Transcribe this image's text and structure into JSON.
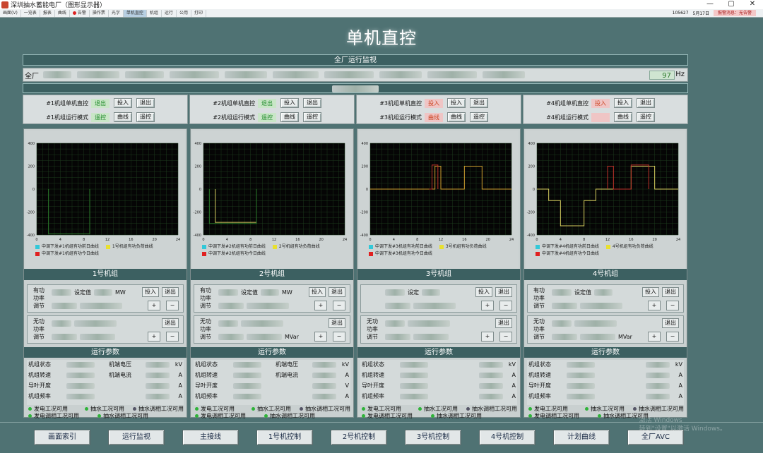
{
  "window": {
    "title": "深圳抽水蓄能电厂（图形显示器）",
    "buttons": {
      "minimize": "—",
      "maximize": "▢",
      "close": "✕"
    }
  },
  "toolbar": {
    "items": [
      "画面(V)",
      "一览表",
      "报表",
      "曲线",
      "告警",
      "操作票",
      "光字",
      "单机直控",
      "机组",
      "运行",
      "公用",
      "打印"
    ],
    "right_items": [
      "105627",
      "5月17日"
    ],
    "alarm_label": "报警消息：无告警"
  },
  "page": {
    "title": "单机直控"
  },
  "plant": {
    "section_title": "全厂运行监视",
    "row_label": "全厂",
    "frequency_value": "97",
    "frequency_unit": "Hz"
  },
  "controls": [
    {
      "direct_label": "#1机组单机直控",
      "direct_status": "退出",
      "mode_label": "#1机组运行模式",
      "mode_status": "遥控",
      "btn_in": "投入",
      "btn_out": "退出",
      "btn_curve": "曲线",
      "btn_remote": "遥控"
    },
    {
      "direct_label": "#2机组单机直控",
      "direct_status": "退出",
      "mode_label": "#2机组运行模式",
      "mode_status": "遥控",
      "btn_in": "投入",
      "btn_out": "退出",
      "btn_curve": "曲线",
      "btn_remote": "遥控"
    },
    {
      "direct_label": "#3机组单机直控",
      "direct_status": "投入",
      "mode_label": "#3机组运行模式",
      "mode_status": "曲线",
      "btn_in": "投入",
      "btn_out": "退出",
      "btn_curve": "曲线",
      "btn_remote": "遥控"
    },
    {
      "direct_label": "#4机组单机直控",
      "direct_status": "投入",
      "mode_label": "#4机组运行模式",
      "mode_status": "",
      "btn_in": "投入",
      "btn_out": "退出",
      "btn_curve": "曲线",
      "btn_remote": "遥控"
    }
  ],
  "units": [
    {
      "title": "1号机组",
      "legend": [
        "中调下发#1机组有功前日曲线",
        "1号机组有功负荷曲线",
        "中调下发#1机组有功今日曲线"
      ],
      "p_label": "有功\n功率\n调节",
      "q_label": "无功\n功率\n调节",
      "set_label": "设定值",
      "p_unit": "MW",
      "q_unit": "",
      "btn_in": "投入",
      "btn_out": "退出",
      "plus": "+",
      "minus": "−",
      "param_title": "运行参数",
      "params_left": [
        "机组状态",
        "机组转速",
        "导叶开度",
        "机组频率"
      ],
      "params_right": [
        "机端电压",
        "机端电流",
        "",
        ""
      ],
      "units_right": [
        "kV",
        "A",
        "A",
        "A"
      ],
      "cond": [
        "发电工况可用",
        "抽水工况可用",
        "抽水调相工况可用",
        "发电调相工况可用",
        "抽水调相工况可用"
      ]
    },
    {
      "title": "2号机组",
      "legend": [
        "中调下发#2机组有功前日曲线",
        "2号机组有功负荷曲线",
        "中调下发#2机组有功今日曲线"
      ],
      "p_label": "有功\n功率\n调节",
      "q_label": "无功\n功率\n调节",
      "set_label": "设定值",
      "p_unit": "MW",
      "q_unit": "MVar",
      "btn_in": "投入",
      "btn_out": "退出",
      "plus": "+",
      "minus": "−",
      "param_title": "运行参数",
      "params_left": [
        "机组状态",
        "机组转速",
        "导叶开度",
        "机组频率"
      ],
      "params_right": [
        "机端电压",
        "机端电流",
        "",
        ""
      ],
      "units_right": [
        "kV",
        "A",
        "V",
        "A"
      ],
      "cond": [
        "发电工况可用",
        "抽水工况可用",
        "抽水调相工况可用",
        "发电调相工况可用",
        "抽水调相工况可用"
      ]
    },
    {
      "title": "3号机组",
      "legend": [
        "中调下发#3机组有功前日曲线",
        "3号机组有功负荷曲线",
        "中调下发#3机组有功今日曲线"
      ],
      "p_label": "",
      "q_label": "无功\n功率\n调节",
      "set_label": "设定",
      "p_unit": "",
      "q_unit": "",
      "btn_in": "投入",
      "btn_out": "退出",
      "plus": "+",
      "minus": "−",
      "param_title": "运行参数",
      "params_left": [
        "机组状态",
        "机组转速",
        "导叶开度",
        "机组频率"
      ],
      "params_right": [
        "",
        "",
        "",
        ""
      ],
      "units_right": [
        "kV",
        "A",
        "A",
        "A"
      ],
      "cond": [
        "发电工况可用",
        "抽水工况可用",
        "抽水调相工况可用",
        "发电调相工况可用",
        "抽水调相工况可用"
      ]
    },
    {
      "title": "4号机组",
      "legend": [
        "中调下发#4机组有功前日曲线",
        "4号机组有功负荷曲线",
        "中调下发#4机组有功今日曲线"
      ],
      "p_label": "有功\n功率\n调节",
      "q_label": "无功\n功率\n调节",
      "set_label": "设定值",
      "p_unit": "",
      "q_unit": "MVar",
      "btn_in": "投入",
      "btn_out": "退出",
      "plus": "+",
      "minus": "−",
      "param_title": "运行参数",
      "params_left": [
        "机组状态",
        "机组转速",
        "导叶开度",
        "机组频率"
      ],
      "params_right": [
        "",
        "",
        "",
        ""
      ],
      "units_right": [
        "kV",
        "A",
        "A",
        "A"
      ],
      "cond": [
        "发电工况可用",
        "抽水工况可用",
        "抽水调相工况可用",
        "发电调相工况可用",
        "抽水调相工况可用"
      ]
    }
  ],
  "chart_data": [
    {
      "type": "line",
      "title": "",
      "xlabel": "",
      "ylabel": "",
      "xlim": [
        0,
        24
      ],
      "ylim": [
        -400,
        400
      ],
      "x_ticks": [
        0,
        4,
        8,
        12,
        16,
        20,
        24
      ],
      "y_ticks": [
        400,
        200,
        0,
        -200,
        -400
      ],
      "grid": true,
      "series": [
        {
          "color": "#2a7a2a",
          "points": [
            [
              2,
              0
            ],
            [
              2,
              -390
            ],
            [
              9,
              -390
            ],
            [
              9,
              0
            ]
          ]
        }
      ]
    },
    {
      "type": "line",
      "title": "",
      "xlabel": "",
      "ylabel": "",
      "xlim": [
        0,
        24
      ],
      "ylim": [
        -400,
        400
      ],
      "x_ticks": [
        0,
        4,
        8,
        12,
        16,
        20,
        24
      ],
      "y_ticks": [
        400,
        200,
        0,
        -200,
        -400
      ],
      "grid": true,
      "series": [
        {
          "color": "#d8d060",
          "points": [
            [
              2,
              0
            ],
            [
              2,
              -290
            ],
            [
              9,
              -290
            ],
            [
              9,
              0
            ]
          ]
        },
        {
          "color": "#2a7a2a",
          "points": [
            [
              1,
              0
            ],
            [
              1,
              -300
            ],
            [
              9,
              -300
            ],
            [
              9,
              0
            ]
          ]
        }
      ]
    },
    {
      "type": "line",
      "title": "",
      "xlabel": "",
      "ylabel": "",
      "xlim": [
        0,
        24
      ],
      "ylim": [
        -400,
        400
      ],
      "x_ticks": [
        0,
        4,
        8,
        12,
        16,
        20,
        24
      ],
      "y_ticks": [
        400,
        200,
        0,
        -200,
        -400
      ],
      "grid": true,
      "series": [
        {
          "color": "#d0a030",
          "points": [
            [
              0,
              0
            ],
            [
              11,
              0
            ],
            [
              11,
              200
            ],
            [
              12,
              200
            ],
            [
              12,
              0
            ],
            [
              16,
              0
            ],
            [
              16,
              200
            ],
            [
              19,
              200
            ],
            [
              19,
              0
            ],
            [
              24,
              0
            ]
          ]
        },
        {
          "color": "#c0332a",
          "points": [
            [
              10,
              0
            ],
            [
              10.5,
              0
            ],
            [
              10.5,
              210
            ],
            [
              11.5,
              210
            ],
            [
              11.5,
              0
            ]
          ]
        }
      ]
    },
    {
      "type": "line",
      "title": "",
      "xlabel": "",
      "ylabel": "",
      "xlim": [
        0,
        24
      ],
      "ylim": [
        -400,
        400
      ],
      "x_ticks": [
        0,
        4,
        8,
        12,
        16,
        20,
        24
      ],
      "y_ticks": [
        400,
        200,
        0,
        -200,
        -400
      ],
      "grid": true,
      "series": [
        {
          "color": "#d8d060",
          "points": [
            [
              0,
              0
            ],
            [
              2,
              0
            ],
            [
              2,
              -100
            ],
            [
              4,
              -100
            ],
            [
              4,
              -320
            ],
            [
              8,
              -320
            ],
            [
              8,
              -100
            ],
            [
              10,
              -100
            ],
            [
              10,
              0
            ],
            [
              16,
              0
            ],
            [
              16,
              200
            ],
            [
              20,
              200
            ],
            [
              20,
              0
            ],
            [
              24,
              0
            ]
          ]
        },
        {
          "color": "#c0332a",
          "points": [
            [
              12,
              0
            ],
            [
              12,
              200
            ],
            [
              13,
              200
            ],
            [
              13,
              0
            ],
            [
              16,
              0
            ],
            [
              16,
              210
            ],
            [
              19,
              210
            ],
            [
              19,
              0
            ]
          ]
        }
      ]
    }
  ],
  "legend_colors": [
    "#33c8d8",
    "#e8e030",
    "#e02020"
  ],
  "nav": [
    "画面索引",
    "运行监视",
    "主接线",
    "1号机控制",
    "2号机控制",
    "3号机控制",
    "4号机控制",
    "计划曲线",
    "全厂AVC"
  ],
  "watermark": {
    "line1": "激活 Windows",
    "line2": "转到\"设置\"以激活 Windows。"
  }
}
